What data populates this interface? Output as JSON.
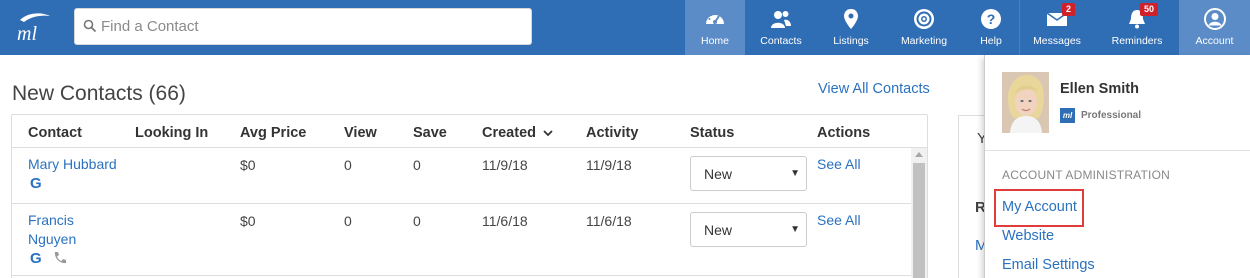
{
  "search": {
    "placeholder": "Find a Contact"
  },
  "nav": {
    "home": "Home",
    "contacts": "Contacts",
    "listings": "Listings",
    "marketing": "Marketing",
    "help": "Help",
    "messages": "Messages",
    "messages_badge": "2",
    "reminders": "Reminders",
    "reminders_badge": "50",
    "account": "Account"
  },
  "section": {
    "title": "New Contacts (66)",
    "view_all": "View All Contacts"
  },
  "table": {
    "headers": {
      "contact": "Contact",
      "looking_in": "Looking In",
      "avg_price": "Avg Price",
      "view": "View",
      "save": "Save",
      "created": "Created",
      "activity": "Activity",
      "status": "Status",
      "actions": "Actions"
    },
    "rows": [
      {
        "name": "Mary Hubbard",
        "name_line2": "",
        "avg_price": "$0",
        "view": "0",
        "save": "0",
        "created": "11/9/18",
        "activity": "11/9/18",
        "status": "New",
        "action": "See All"
      },
      {
        "name": "Francis",
        "name_line2": "Nguyen",
        "avg_price": "$0",
        "view": "0",
        "save": "0",
        "created": "11/6/18",
        "activity": "11/6/18",
        "status": "New",
        "action": "See All"
      }
    ]
  },
  "right_panel": {
    "letter1": "Y",
    "letter2": "R",
    "letter3": "M"
  },
  "account_menu": {
    "user_name": "Ellen Smith",
    "plan_icon_text": "ml",
    "plan": "Professional",
    "header": "ACCOUNT ADMINISTRATION",
    "items": [
      "My Account",
      "Website",
      "Email Settings"
    ]
  },
  "colors": {
    "brand": "#2f6db5",
    "link": "#2a72c0",
    "highlight": "#e03c3c",
    "badge": "#d0202a"
  },
  "icons": {
    "logo": "ml-logo",
    "home": "dashboard-gauge-icon",
    "contacts": "people-icon",
    "listings": "map-pin-icon",
    "marketing": "target-icon",
    "help": "question-icon",
    "messages": "envelope-icon",
    "reminders": "bell-icon",
    "account": "user-circle-icon"
  }
}
